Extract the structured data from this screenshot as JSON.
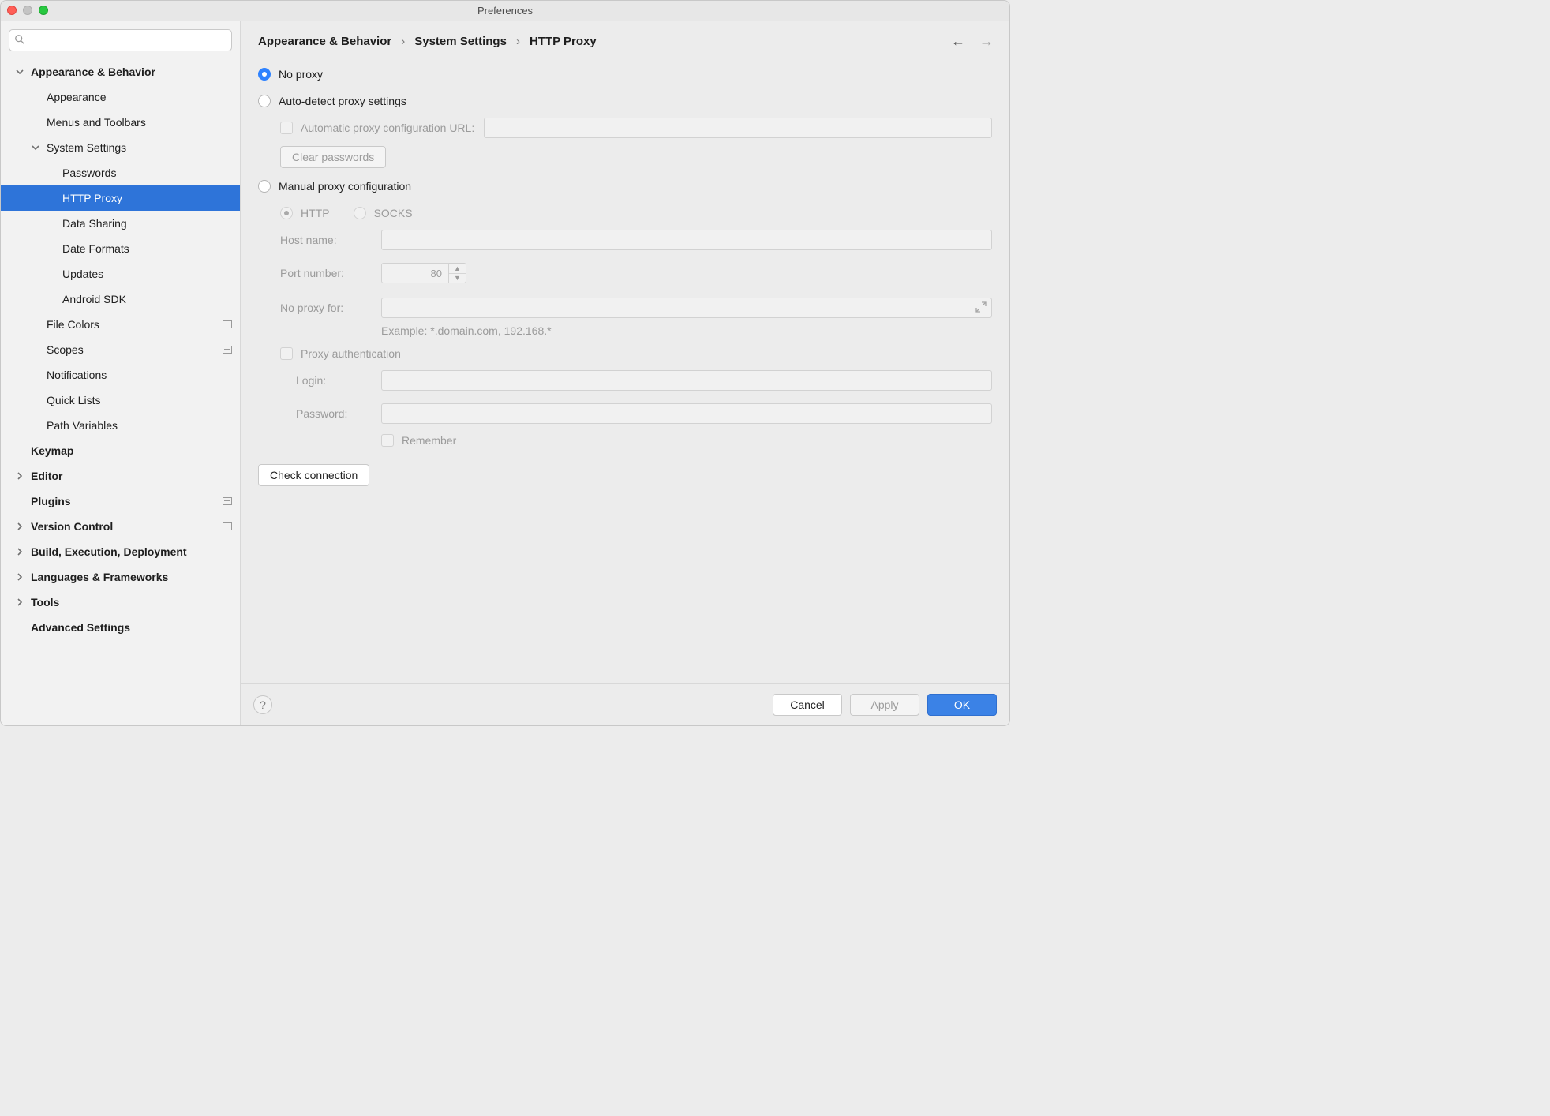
{
  "window": {
    "title": "Preferences"
  },
  "sidebar": {
    "search_placeholder": "",
    "items": [
      {
        "label": "Appearance & Behavior",
        "level": 0,
        "bold": true,
        "expandable": true,
        "expanded": true
      },
      {
        "label": "Appearance",
        "level": 1,
        "bold": false
      },
      {
        "label": "Menus and Toolbars",
        "level": 1,
        "bold": false
      },
      {
        "label": "System Settings",
        "level": 1,
        "bold": false,
        "expandable": true,
        "expanded": true
      },
      {
        "label": "Passwords",
        "level": 2,
        "bold": false
      },
      {
        "label": "HTTP Proxy",
        "level": 2,
        "bold": false,
        "selected": true
      },
      {
        "label": "Data Sharing",
        "level": 2,
        "bold": false
      },
      {
        "label": "Date Formats",
        "level": 2,
        "bold": false
      },
      {
        "label": "Updates",
        "level": 2,
        "bold": false
      },
      {
        "label": "Android SDK",
        "level": 2,
        "bold": false
      },
      {
        "label": "File Colors",
        "level": 1,
        "bold": false,
        "badge": true
      },
      {
        "label": "Scopes",
        "level": 1,
        "bold": false,
        "badge": true
      },
      {
        "label": "Notifications",
        "level": 1,
        "bold": false
      },
      {
        "label": "Quick Lists",
        "level": 1,
        "bold": false
      },
      {
        "label": "Path Variables",
        "level": 1,
        "bold": false
      },
      {
        "label": "Keymap",
        "level": 0,
        "bold": true
      },
      {
        "label": "Editor",
        "level": 0,
        "bold": true,
        "expandable": true,
        "expanded": false
      },
      {
        "label": "Plugins",
        "level": 0,
        "bold": true,
        "badge": true
      },
      {
        "label": "Version Control",
        "level": 0,
        "bold": true,
        "expandable": true,
        "expanded": false,
        "badge": true
      },
      {
        "label": "Build, Execution, Deployment",
        "level": 0,
        "bold": true,
        "expandable": true,
        "expanded": false
      },
      {
        "label": "Languages & Frameworks",
        "level": 0,
        "bold": true,
        "expandable": true,
        "expanded": false
      },
      {
        "label": "Tools",
        "level": 0,
        "bold": true,
        "expandable": true,
        "expanded": false
      },
      {
        "label": "Advanced Settings",
        "level": 0,
        "bold": true
      }
    ]
  },
  "breadcrumb": {
    "parts": [
      "Appearance & Behavior",
      "System Settings",
      "HTTP Proxy"
    ]
  },
  "main": {
    "no_proxy": "No proxy",
    "auto_detect": "Auto-detect proxy settings",
    "auto_url_label": "Automatic proxy configuration URL:",
    "auto_url_value": "",
    "clear_passwords": "Clear passwords",
    "manual": "Manual proxy configuration",
    "http": "HTTP",
    "socks": "SOCKS",
    "host_label": "Host name:",
    "host_value": "",
    "port_label": "Port number:",
    "port_value": "80",
    "noproxyfor_label": "No proxy for:",
    "noproxyfor_value": "",
    "example": "Example: *.domain.com, 192.168.*",
    "proxy_auth": "Proxy authentication",
    "login_label": "Login:",
    "login_value": "",
    "password_label": "Password:",
    "password_value": "",
    "remember": "Remember",
    "check_connection": "Check connection"
  },
  "footer": {
    "cancel": "Cancel",
    "apply": "Apply",
    "ok": "OK"
  }
}
